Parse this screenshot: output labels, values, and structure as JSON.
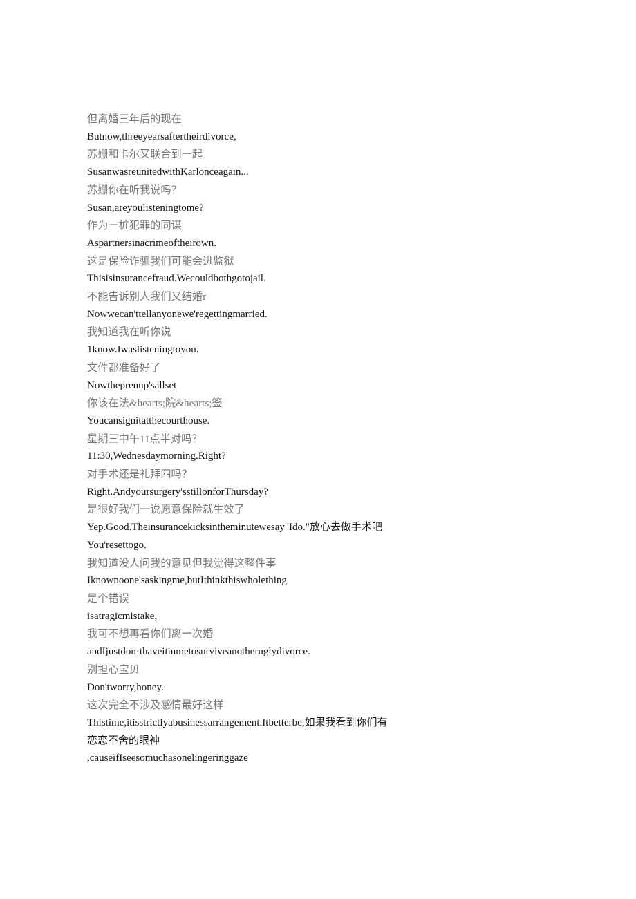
{
  "document": {
    "kind": "bilingual-subtitle-transcript",
    "background_color": "#ffffff",
    "chinese_color": "#77777a",
    "english_color": "#16161a",
    "lines": [
      {
        "lang": "zh",
        "text": "但离婚三年后的现在"
      },
      {
        "lang": "en",
        "text": "Butnow,threeyearsaftertheirdivorce,"
      },
      {
        "lang": "zh",
        "text": "苏姗和卡尔又联合到一起"
      },
      {
        "lang": "en",
        "text": "SusanwasreunitedwithKarlonceagain..."
      },
      {
        "lang": "zh",
        "text": "苏姗你在听我说吗？"
      },
      {
        "lang": "en",
        "text": "Susan,areyoulisteningtome?"
      },
      {
        "lang": "zh",
        "text": "作为一桩犯罪的同谋"
      },
      {
        "lang": "en",
        "text": "Aspartnersinacrimeoftheirown."
      },
      {
        "lang": "zh",
        "text": "这是保险诈骗我们可能会进监狱"
      },
      {
        "lang": "en",
        "text": "Thisisinsurancefraud.Wecouldbothgotojail."
      },
      {
        "lang": "zh",
        "text": "不能告诉别人我们又结婚r"
      },
      {
        "lang": "en",
        "text": "Nowwecan'ttellanyonewe'regettingmarried."
      },
      {
        "lang": "zh",
        "text": "我知道我在听你说"
      },
      {
        "lang": "en",
        "text": "1know.Iwaslisteningtoyou."
      },
      {
        "lang": "zh",
        "text": "文件都准备好了"
      },
      {
        "lang": "en",
        "text": "Nowtheprenup'sallset"
      },
      {
        "lang": "zh",
        "text": "你该在法&hearts;院&hearts;签"
      },
      {
        "lang": "en",
        "text": "Youcansignitatthecourthouse."
      },
      {
        "lang": "zh",
        "text": "星期三中午11点半对吗？"
      },
      {
        "lang": "en",
        "text": "11:30,Wednesdaymorning.Right?"
      },
      {
        "lang": "zh",
        "text": "对手术还是礼拜四吗？"
      },
      {
        "lang": "en",
        "text": "Right.Andyoursurgery'sstillonforThursday?"
      },
      {
        "lang": "zh",
        "text": "是很好我们一说愿意保险就生效了"
      },
      {
        "lang": "en",
        "text": "Yep.Good.Theinsurancekicksintheminutewesay\"Ido.\"放心去做手术吧"
      },
      {
        "lang": "en",
        "text": "You'resettogo."
      },
      {
        "lang": "zh",
        "text": "我知道没人问我的意见但我觉得这整件事"
      },
      {
        "lang": "en",
        "text": "Iknownoone'saskingme,butIthinkthiswholething"
      },
      {
        "lang": "zh",
        "text": "是个错误"
      },
      {
        "lang": "en",
        "text": "isatragicmistake,"
      },
      {
        "lang": "zh",
        "text": "我可不想再看你们离一次婚"
      },
      {
        "lang": "en",
        "text": "andIjustdon·thaveitinmetosurviveanotheruglydivorce."
      },
      {
        "lang": "zh",
        "text": "别担心宝贝"
      },
      {
        "lang": "en",
        "text": "Don'tworry,honey."
      },
      {
        "lang": "zh",
        "text": "这次完全不涉及感情最好这样"
      },
      {
        "lang": "en",
        "text": "Thistime,itisstrictlyabusinessarrangement.Itbetterbe,如果我看到你们有恋恋不舍的眼神"
      },
      {
        "lang": "en",
        "text": ",causeifIseesomuchasonelingeringgaze"
      }
    ]
  }
}
